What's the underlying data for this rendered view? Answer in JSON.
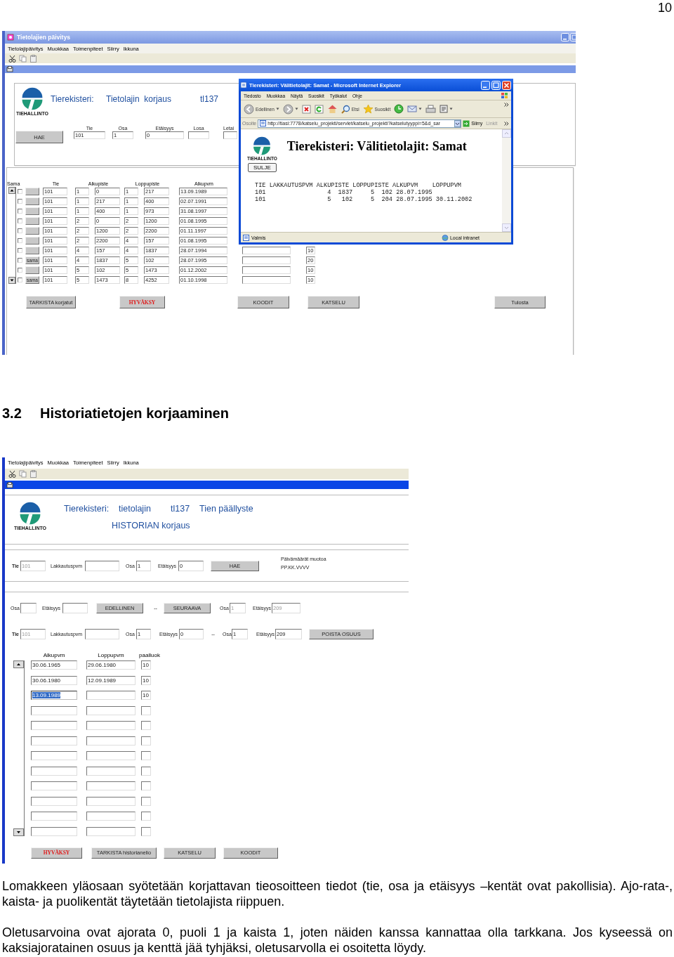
{
  "page_number": "10",
  "forms_window": {
    "title": "Tietolajien päivitys",
    "menu": [
      "Tietolajipäivitys",
      "Muokkaa",
      "Toimenpiteet",
      "Siirry",
      "Ikkuna"
    ],
    "logo_text": "TIEHALLINTO",
    "heading": [
      "Tierekisteri:",
      "Tietolajin  korjaus",
      "tl137"
    ],
    "search_button": "HAE",
    "search_fields": [
      {
        "label": "Tie",
        "value": "101"
      },
      {
        "label": "Osa",
        "value": "1"
      },
      {
        "label": "Etäisyys",
        "value": "0"
      },
      {
        "label": "Losa"
      },
      {
        "label": "Letai"
      }
    ],
    "grid": {
      "columns": [
        "Sama",
        "Tie",
        "Alkupiste",
        "Loppupiste",
        "Alkupvm"
      ],
      "rows": [
        {
          "checked": false,
          "tie": "101",
          "start_part": "1",
          "start_dist": "0",
          "end_part": "1",
          "end_dist": "217",
          "start_date": "13.09.1989"
        },
        {
          "checked": false,
          "tie": "101",
          "start_part": "1",
          "start_dist": "217",
          "end_part": "1",
          "end_dist": "400",
          "start_date": "02.07.1991"
        },
        {
          "checked": false,
          "tie": "101",
          "start_part": "1",
          "start_dist": "400",
          "end_part": "1",
          "end_dist": "973",
          "start_date": "31.08.1997"
        },
        {
          "checked": false,
          "tie": "101",
          "start_part": "2",
          "start_dist": "0",
          "end_part": "2",
          "end_dist": "1200",
          "start_date": "01.08.1995"
        },
        {
          "checked": false,
          "tie": "101",
          "start_part": "2",
          "start_dist": "1200",
          "end_part": "2",
          "end_dist": "2200",
          "start_date": "01.11.1997"
        },
        {
          "checked": false,
          "tie": "101",
          "start_part": "2",
          "start_dist": "2200",
          "end_part": "4",
          "end_dist": "157",
          "start_date": "01.08.1995"
        },
        {
          "checked": false,
          "tie": "101",
          "start_part": "4",
          "start_dist": "157",
          "end_part": "4",
          "end_dist": "1837",
          "start_date": "28.07.1994",
          "extra": "10"
        },
        {
          "checked": false,
          "same": "sama",
          "tie": "101",
          "start_part": "4",
          "start_dist": "1837",
          "end_part": "5",
          "end_dist": "102",
          "start_date": "28.07.1995",
          "extra": "20"
        },
        {
          "checked": false,
          "tie": "101",
          "start_part": "5",
          "start_dist": "102",
          "end_part": "5",
          "end_dist": "1473",
          "start_date": "01.12.2002",
          "extra": "10"
        },
        {
          "checked": false,
          "same": "sama",
          "tie": "101",
          "start_part": "5",
          "start_dist": "1473",
          "end_part": "8",
          "end_dist": "4252",
          "start_date": "01.10.1998",
          "extra": "10"
        }
      ]
    },
    "buttons": [
      {
        "label": "TARKISTA korjatut",
        "kind": "normal"
      },
      {
        "label": "HYVÄKSY",
        "kind": "accept"
      },
      {
        "label": "KOODIT",
        "kind": "normal"
      },
      {
        "label": "KATSELU",
        "kind": "normal"
      },
      {
        "label": "Tulosta",
        "kind": "normal"
      }
    ]
  },
  "browser_window": {
    "title": "Tierekisteri: Välitietolajit: Samat - Microsoft Internet Explorer",
    "menu": [
      "Tiedosto",
      "Muokkaa",
      "Näytä",
      "Suosikit",
      "Työkalut",
      "Ohje"
    ],
    "toolbar": {
      "back": "Edellinen",
      "search": "Etsi",
      "favorites": "Suosikit"
    },
    "address": {
      "label": "Osoite",
      "url": "http://tiasi:7778/katselu_projekti/servlet/katselu_projekti?katselutyyppi=5&d_sar",
      "go": "Siirry",
      "links": "Linkit"
    },
    "page": {
      "logo_text": "TIEHALLINTO",
      "title": "Tierekisteri: Välitietolajit: Samat",
      "close_button": "SULJE",
      "header": "TIE LAKKAUTUSPVM ALKUPISTE LOPPUPISTE ALKUPVM    LOPPUPVM",
      "lines": [
        "101                 4  1837     5  102 28.07.1995",
        "101                 5   102     5  204 28.07.1995 30.11.2002"
      ]
    },
    "status": {
      "text": "Valmis",
      "zone": "Local intranet"
    }
  },
  "section": {
    "number": "3.2",
    "title": "Historiatietojen korjaaminen"
  },
  "history_window": {
    "menu": [
      "Tietolajipäivitys",
      "Muokkaa",
      "Toimenpiteet",
      "Siirry",
      "Ikkuna"
    ],
    "logo_text": "TIEHALLINTO",
    "heading": [
      "Tierekisteri:",
      "tietolajin",
      "tl137",
      "Tien päällyste"
    ],
    "subtitle": "HISTORIAN korjaus",
    "rows": [
      [
        {
          "kind": "key-field",
          "label": "Tie",
          "value": "101",
          "disabled": true
        },
        {
          "kind": "field",
          "label": "Lakkautuspvm"
        },
        {
          "kind": "field",
          "label": "Osa",
          "value": "1",
          "disabled": false
        },
        {
          "kind": "field",
          "label": "Etäisyys",
          "value": "0",
          "disabled": false
        },
        {
          "kind": "button",
          "label": "HAE"
        },
        {
          "kind": "note",
          "lines": [
            "Päivämäärät muotoa",
            "PP.KK.VVVV"
          ]
        }
      ],
      [
        {
          "kind": "field",
          "label": "Osa"
        },
        {
          "kind": "field",
          "label": "Etäisyys"
        },
        {
          "kind": "button",
          "label": "EDELLINEN"
        },
        {
          "kind": "separator",
          "text": "--"
        },
        {
          "kind": "button",
          "label": "SEURAAVA"
        },
        {
          "kind": "field",
          "label": "Osa",
          "value": "1",
          "disabled": true
        },
        {
          "kind": "field",
          "label": "Etäisyys",
          "value": "209",
          "disabled": true
        }
      ],
      [
        {
          "kind": "key-field",
          "label": "Tie",
          "value": "101",
          "disabled": true
        },
        {
          "kind": "field",
          "label": "Lakkautuspvm"
        },
        {
          "kind": "field",
          "label": "Osa",
          "value": "1",
          "disabled": false
        },
        {
          "kind": "field",
          "label": "Etäisyys",
          "value": "0",
          "disabled": false
        },
        {
          "kind": "separator",
          "text": "--"
        },
        {
          "kind": "field",
          "label": "Osa",
          "value": "1",
          "disabled": false
        },
        {
          "kind": "field",
          "label": "Etäisyys",
          "value": "209",
          "disabled": false
        },
        {
          "kind": "button",
          "label": "POISTA OSUUS"
        }
      ]
    ],
    "grid": {
      "columns": [
        "Alkupvm",
        "Loppupvm",
        "paalluok"
      ],
      "rows": [
        {
          "start": "30.06.1965",
          "end": "29.06.1980",
          "class": "10",
          "selected": false
        },
        {
          "start": "30.06.1980",
          "end": "12.09.1989",
          "class": "10",
          "selected": false
        },
        {
          "start": "13.09.1989",
          "class": "10",
          "selected": true
        },
        {
          "selected": false
        },
        {
          "selected": false
        },
        {
          "selected": false
        },
        {
          "selected": false
        },
        {
          "selected": false
        },
        {
          "selected": false
        },
        {
          "selected": false
        },
        {
          "selected": false
        },
        {
          "selected": false
        }
      ]
    },
    "buttons": [
      {
        "label": "HYVÄKSY",
        "kind": "accept"
      },
      {
        "label": "TARKISTA historianelio",
        "kind": "normal"
      },
      {
        "label": "KATSELU",
        "kind": "normal"
      },
      {
        "label": "KOODIT",
        "kind": "normal"
      }
    ]
  },
  "paragraphs": [
    "Lomakkeen yläosaan syötetään korjattavan tieosoitteen tiedot (tie, osa ja etäisyys –kentät ovat pakollisia). Ajo-rata-, kaista- ja puolikentät täytetään tietolajista riippuen.",
    "Oletusarvoina ovat ajorata 0, puoli 1 ja kaista 1, joten näiden kanssa kannattaa olla tarkkana. Jos kyseessä on kaksiajoratainen osuus ja kenttä jää tyhjäksi, oletusarvolla ei osoitetta löydy."
  ]
}
